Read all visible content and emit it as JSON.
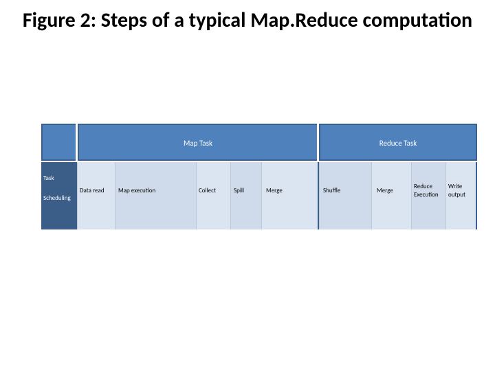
{
  "title": "Figure 2: Steps of a typical Map.Reduce computation",
  "header": {
    "map": "Map Task",
    "reduce": "Reduce Task"
  },
  "left_labels": {
    "task": "Task",
    "scheduling": "Scheduling"
  },
  "steps": {
    "data_read": "Data read",
    "map_exec": "Map execution",
    "collect": "Collect",
    "spill": "Spill",
    "merge1": "Merge",
    "shuffle": "Shuffle",
    "merge2": "Merge",
    "reduce_line1": "Reduce",
    "reduce_line2": "Execution",
    "write_line1": "Write",
    "write_line2": "output"
  },
  "chart_data": {
    "type": "table",
    "title": "Figure 2: Steps of a typical Map.Reduce computation",
    "groups": [
      {
        "name": "Map Task",
        "steps": [
          "Data read",
          "Map execution",
          "Collect",
          "Spill",
          "Merge"
        ]
      },
      {
        "name": "Reduce Task",
        "steps": [
          "Shuffle",
          "Merge",
          "Reduce Execution",
          "Write output"
        ]
      }
    ],
    "row_label": [
      "Task",
      "Scheduling"
    ]
  }
}
